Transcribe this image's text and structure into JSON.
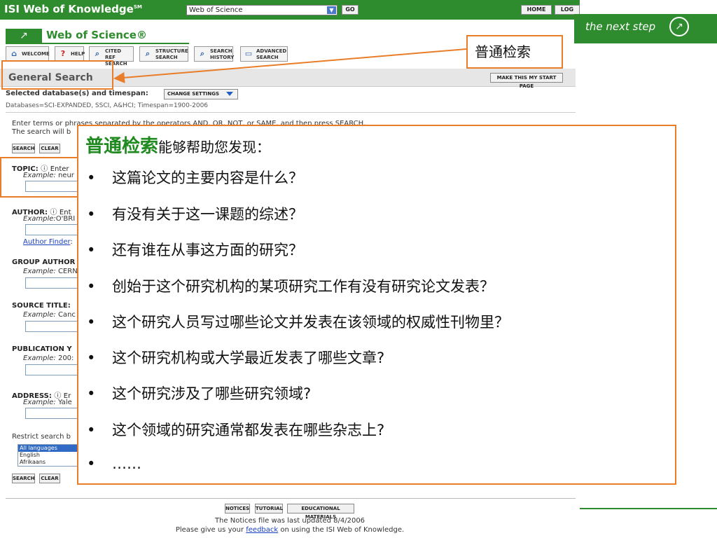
{
  "header": {
    "brand": "ISI Web of Knowledge",
    "brand_mark": "SM",
    "db_select": "Web of Science",
    "go": "GO",
    "home": "HOME",
    "logout": "LOG OUT",
    "slogan": "the next step"
  },
  "product": {
    "name": "Web of Science",
    "mark": "®"
  },
  "toolbar": [
    {
      "icon": "welcome-icon",
      "l1": "WELCOME",
      "l2": ""
    },
    {
      "icon": "help-icon",
      "l1": "HELP",
      "l2": ""
    },
    {
      "icon": "cited-ref-icon",
      "l1": "CITED REF",
      "l2": "SEARCH"
    },
    {
      "icon": "structure-icon",
      "l1": "STRUCTURE",
      "l2": "SEARCH"
    },
    {
      "icon": "history-icon",
      "l1": "SEARCH",
      "l2": "HISTORY"
    },
    {
      "icon": "advanced-icon",
      "l1": "ADVANCED",
      "l2": "SEARCH"
    }
  ],
  "page": {
    "title": "General Search",
    "make_start": "MAKE THIS MY START PAGE",
    "selected_label": "Selected database(s) and timespan:",
    "change_settings": "CHANGE SETTINGS",
    "databases": "Databases=SCI-EXPANDED, SSCI, A&HCI; Timespan=1900-2006",
    "instr1": "Enter terms or phrases separated by the operators AND, OR, NOT, or SAME, and then press SEARCH.",
    "instr2": "The search will b",
    "search": "SEARCH",
    "clear": "CLEAR"
  },
  "fields": {
    "topic": {
      "label": "TOPIC:",
      "hint": "Enter",
      "ex": "Example:",
      "ex_val": "neur"
    },
    "author": {
      "label": "AUTHOR:",
      "hint": "Ent",
      "ex": "Example:",
      "ex_val": "O'BRI",
      "finder": "Author Finder"
    },
    "group": {
      "label": "GROUP AUTHOR",
      "ex": "Example:",
      "ex_val": "CERN"
    },
    "source": {
      "label": "SOURCE TITLE:",
      "ex": "Example:",
      "ex_val": "Canc"
    },
    "pubyear": {
      "label": "PUBLICATION Y",
      "ex": "Example:",
      "ex_val": "200:"
    },
    "address": {
      "label": "ADDRESS:",
      "hint": "Er",
      "ex": "Example:",
      "ex_val": "Yale"
    },
    "restrict": "Restrict search b",
    "languages": [
      "All languages",
      "English",
      "Afrikaans"
    ]
  },
  "footer": {
    "notices": "NOTICES",
    "tutorial": "TUTORIAL",
    "edu": "EDUCATIONAL MATERIALS",
    "line1": "The Notices file was last updated 8/4/2006",
    "line2_pre": "Please give us your ",
    "line2_link": "feedback",
    "line2_post": " on using the ISI Web of Knowledge."
  },
  "callout": "普通检索",
  "overlay": {
    "title_hl": "普通检索",
    "title_rest": "能够帮助您发现：",
    "bullets": [
      "这篇论文的主要内容是什么？",
      "有没有关于这一课题的综述？",
      "还有谁在从事这方面的研究？",
      "创始于这个研究机构的某项研究工作有没有研究论文发表？",
      "这个研究人员写过哪些论文并发表在该领域的权威性刊物里？",
      "这个研究机构或大学最近发表了哪些文章?",
      "这个研究涉及了哪些研究领域?",
      "这个领域的研究通常都发表在哪些杂志上?",
      "……"
    ],
    "bullet_char": "•"
  },
  "colors": {
    "brand_green": "#2e8b2e",
    "callout_orange": "#e87d2a",
    "highlight_green": "#1f8a1f"
  }
}
